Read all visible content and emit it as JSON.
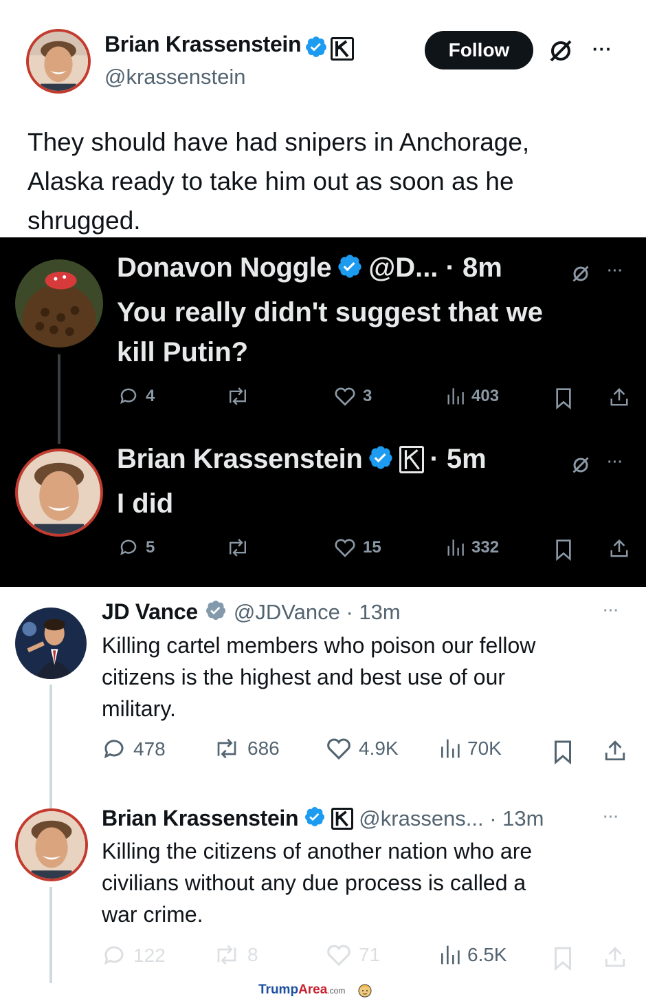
{
  "top_tweet": {
    "name": "Brian Krassenstein",
    "handle": "@krassenstein",
    "follow_label": "Follow",
    "more": "···",
    "text_lines": [
      "They should have had snipers in Anchorage,",
      "Alaska ready to take him out as soon as he",
      "shrugged."
    ]
  },
  "dark_thread": {
    "reply1": {
      "name": "Donavon Noggle",
      "handle_time": "@D... · 8m",
      "text_lines": [
        "You really didn't suggest that we",
        "kill Putin?"
      ],
      "replies": "4",
      "retweets": "",
      "likes": "3",
      "views": "403",
      "more": "···"
    },
    "reply2": {
      "name": "Brian Krassenstein",
      "time": "· 5m",
      "text": "I did",
      "replies": "5",
      "retweets": "",
      "likes": "15",
      "views": "332",
      "more": "···"
    }
  },
  "light_thread": {
    "tweet1": {
      "name": "JD Vance",
      "handle_time": "@JDVance · 13m",
      "text_lines": [
        "Killing cartel members who poison our fellow",
        "citizens is the highest and best use of our",
        "military."
      ],
      "replies": "478",
      "retweets": "686",
      "likes": "4.9K",
      "views": "70K",
      "more": "···"
    },
    "tweet2": {
      "name": "Brian Krassenstein",
      "handle_time": "@krassens... · 13m",
      "text_lines": [
        "Killing the citizens of another nation who are",
        "civilians without any due process is called a",
        "war crime."
      ],
      "replies": "122",
      "retweets": "8",
      "likes": "71",
      "views": "6.5K",
      "more": "···"
    }
  },
  "footer": {
    "brand_a": "Trump",
    "brand_b": "Area",
    "brand_c": ".com"
  },
  "colors": {
    "verified": "#1d9bf0",
    "dark_bg": "#000000",
    "follow_bg": "#0f1419",
    "muted": "#536471"
  }
}
